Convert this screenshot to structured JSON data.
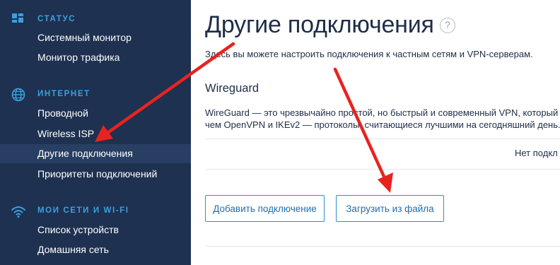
{
  "sidebar": {
    "sections": [
      {
        "label": "СТАТУС",
        "icon": "dashboard-icon",
        "items": [
          {
            "label": "Системный монитор",
            "active": false
          },
          {
            "label": "Монитор трафика",
            "active": false
          }
        ]
      },
      {
        "label": "ИНТЕРНЕТ",
        "icon": "globe-icon",
        "items": [
          {
            "label": "Проводной",
            "active": false
          },
          {
            "label": "Wireless ISP",
            "active": false
          },
          {
            "label": "Другие подключения",
            "active": true
          },
          {
            "label": "Приоритеты подключений",
            "active": false
          }
        ]
      },
      {
        "label": "МОИ СЕТИ И WI-FI",
        "icon": "wifi-icon",
        "items": [
          {
            "label": "Список устройств",
            "active": false
          },
          {
            "label": "Домашняя сеть",
            "active": false
          }
        ]
      }
    ]
  },
  "main": {
    "title": "Другие подключения",
    "help_icon": "?",
    "intro": "Здесь вы можете настроить подключения к частным сетям и VPN-серверам.",
    "wireguard": {
      "title": "Wireguard",
      "description_line1": "WireGuard — это чрезвычайно простой, но быстрый и современный VPN, который ис",
      "description_line2": "чем OpenVPN и IKEv2 — протоколы, считающиеся лучшими на сегодняшний день.",
      "empty_text": "Нет подкл",
      "add_button": "Добавить подключение",
      "upload_button": "Загрузить из файла"
    }
  },
  "colors": {
    "sidebar_bg": "#1e3150",
    "sidebar_active_bg": "#283f63",
    "section_accent": "#3aa0e0",
    "annotation_arrow": "#e8231f",
    "button_border": "#2b8fd6"
  }
}
